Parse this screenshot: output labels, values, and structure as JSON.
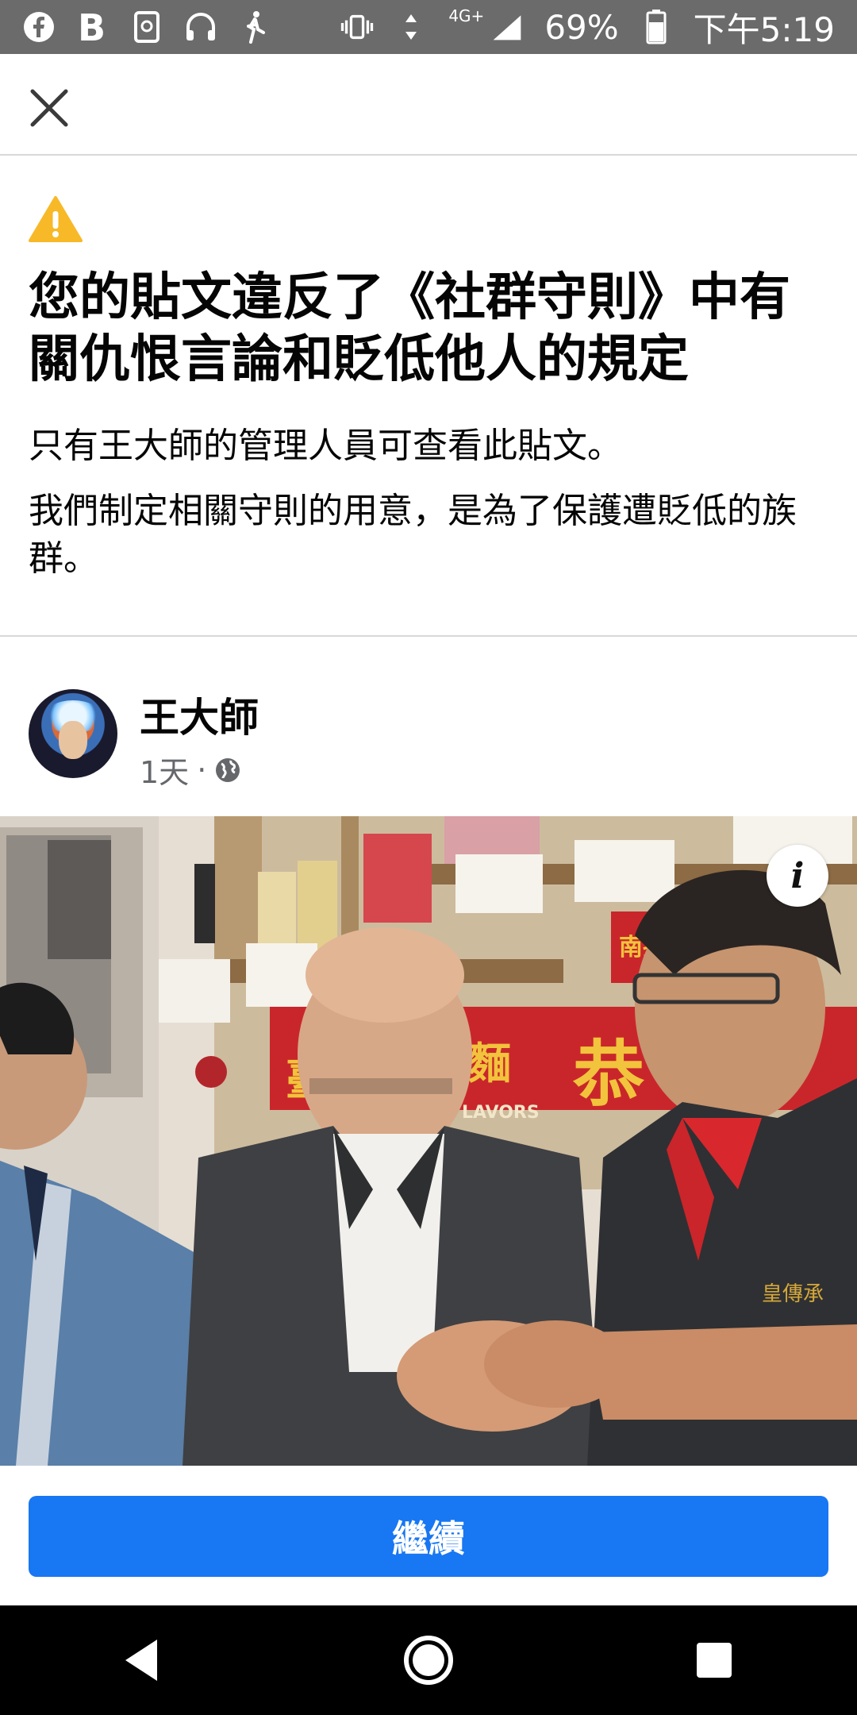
{
  "status_bar": {
    "network_label": "4G+",
    "battery_text": "69%",
    "time_text": "下午5:19",
    "left_icons": [
      "facebook-icon",
      "blogger-icon",
      "screenshot-icon",
      "headphones-icon",
      "walking-icon"
    ]
  },
  "warning": {
    "title": "您的貼文違反了《社群守則》中有關仇恨言論和貶低他人的規定",
    "subtitle": "只有王大師的管理人員可查看此貼文。",
    "description": "我們制定相關守則的用意，是為了保護遭貶低的族群。",
    "icon_color": "#f7b928"
  },
  "post": {
    "author": "王大師",
    "time": "1天",
    "separator": "·",
    "info_label": "i"
  },
  "photo_signs": {
    "sign_a": "臺",
    "sign_b": "麵",
    "sign_c": "恭",
    "sign_d": "LAVORS",
    "sign_e": "南投",
    "shirt_logo": "皇傳承"
  },
  "action": {
    "continue_label": "繼續",
    "accent_color": "#1877f2"
  }
}
